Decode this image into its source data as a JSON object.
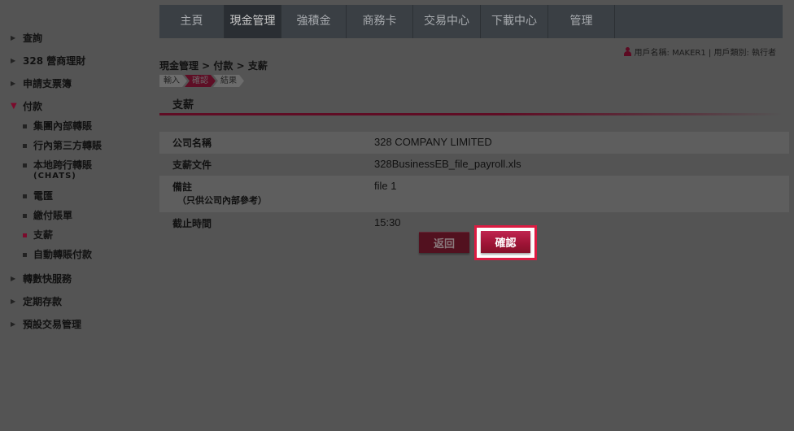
{
  "sidebar": {
    "items": [
      {
        "label": "查詢"
      },
      {
        "label": "328 營商理財"
      },
      {
        "label": "申請支票簿"
      },
      {
        "label": "付款"
      },
      {
        "label": "轉數快服務"
      },
      {
        "label": "定期存款"
      },
      {
        "label": "預設交易管理"
      }
    ],
    "sub_items": [
      {
        "label": "集團內部轉賬"
      },
      {
        "label": "行內第三方轉賬"
      },
      {
        "label": "本地跨行轉賬",
        "label2": "(CHATS)"
      },
      {
        "label": "電匯"
      },
      {
        "label": "繳付賬單"
      },
      {
        "label": "支薪"
      },
      {
        "label": "自動轉賬付款"
      }
    ]
  },
  "nav": {
    "tabs": [
      "主頁",
      "現金管理",
      "強積金",
      "商務卡",
      "交易中心",
      "下載中心",
      "管理"
    ]
  },
  "user": {
    "info": "用戶名稱: MAKER1 | 用戶類別: 執行者"
  },
  "breadcrumb": "現金管理 > 付款 > 支薪",
  "steps": [
    "輸入",
    "確認",
    "結果"
  ],
  "section": {
    "title": "支薪"
  },
  "details": [
    {
      "label": "公司名稱",
      "value": "328 COMPANY LIMITED"
    },
    {
      "label": "支薪文件",
      "value": "328BusinessEB_file_payroll.xls"
    },
    {
      "label": "備註",
      "label2": "（只供公司內部參考）",
      "value": "file 1"
    },
    {
      "label": "截止時間",
      "value": "15:30"
    }
  ],
  "buttons": {
    "back": "返回",
    "confirm": "確認"
  },
  "colors": {
    "accent": "#a01437",
    "highlight": "#dc1b42",
    "nav_bg": "#3a3f44"
  }
}
